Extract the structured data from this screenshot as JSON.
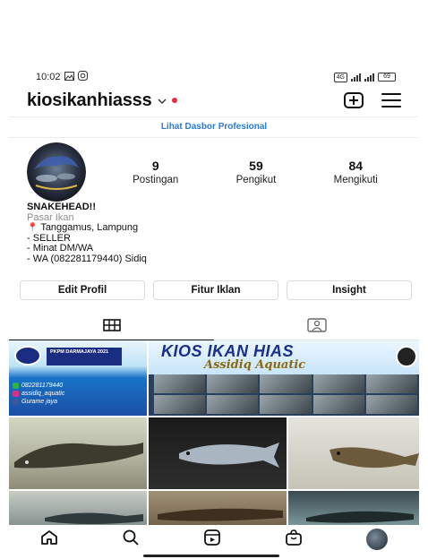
{
  "status_bar": {
    "time": "10:02",
    "battery": "69"
  },
  "header": {
    "username": "kiosikanhiasss"
  },
  "dashboard_link": "Lihat Dasbor Profesional",
  "stats": [
    {
      "value": "9",
      "label": "Postingan"
    },
    {
      "value": "59",
      "label": "Pengikut"
    },
    {
      "value": "84",
      "label": "Mengikuti"
    }
  ],
  "bio": {
    "name": "SNAKEHEAD!!",
    "category": "Pasar Ikan",
    "location": "Tanggamus, Lampung",
    "line1": "- SELLER",
    "line2": "- Minat DM/WA",
    "line3": "- WA (082281179440) Sidiq"
  },
  "buttons": {
    "edit": "Edit Profil",
    "ads": "Fitur Iklan",
    "insight": "Insight"
  },
  "posts": {
    "promo1": {
      "banner": "PKPM DARMAJAYA 2021",
      "phone": "082281179440",
      "instagram": "assidiq_aquatic",
      "facebook": "Gurame jaya"
    },
    "promo2": {
      "title": "KIOS IKAN HIAS",
      "subtitle": "Assidiq Aquatic"
    }
  },
  "colors": {
    "link_blue": "#2b7cd3",
    "notification_red": "#ed2b3d"
  }
}
